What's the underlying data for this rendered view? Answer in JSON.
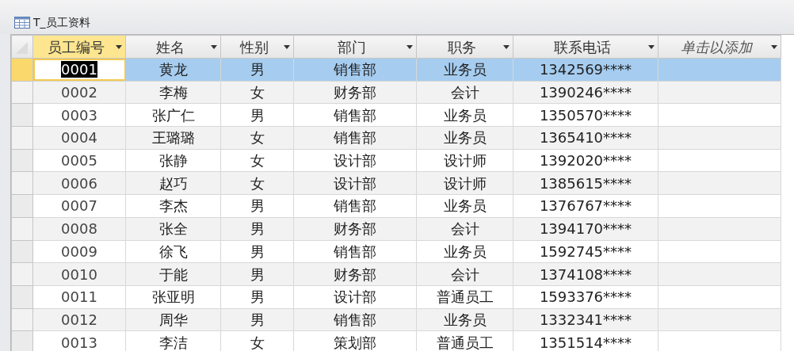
{
  "window": {
    "title": "T_员工资料"
  },
  "columns": [
    {
      "label": "员工编号",
      "selected": true,
      "kind": "field"
    },
    {
      "label": "姓名",
      "selected": false,
      "kind": "field"
    },
    {
      "label": "性别",
      "selected": false,
      "kind": "field"
    },
    {
      "label": "部门",
      "selected": false,
      "kind": "field"
    },
    {
      "label": "职务",
      "selected": false,
      "kind": "field"
    },
    {
      "label": "联系电话",
      "selected": false,
      "kind": "field"
    },
    {
      "label": "单击以添加",
      "selected": false,
      "kind": "add"
    }
  ],
  "rows": [
    {
      "selected": true,
      "cells": [
        "0001",
        "黄龙",
        "男",
        "销售部",
        "业务员",
        "1342569****"
      ]
    },
    {
      "selected": false,
      "cells": [
        "0002",
        "李梅",
        "女",
        "财务部",
        "会计",
        "1390246****"
      ]
    },
    {
      "selected": false,
      "cells": [
        "0003",
        "张广仁",
        "男",
        "销售部",
        "业务员",
        "1350570****"
      ]
    },
    {
      "selected": false,
      "cells": [
        "0004",
        "王璐璐",
        "女",
        "销售部",
        "业务员",
        "1365410****"
      ]
    },
    {
      "selected": false,
      "cells": [
        "0005",
        "张静",
        "女",
        "设计部",
        "设计师",
        "1392020****"
      ]
    },
    {
      "selected": false,
      "cells": [
        "0006",
        "赵巧",
        "女",
        "设计部",
        "设计师",
        "1385615****"
      ]
    },
    {
      "selected": false,
      "cells": [
        "0007",
        "李杰",
        "男",
        "销售部",
        "业务员",
        "1376767****"
      ]
    },
    {
      "selected": false,
      "cells": [
        "0008",
        "张全",
        "男",
        "财务部",
        "会计",
        "1394170****"
      ]
    },
    {
      "selected": false,
      "cells": [
        "0009",
        "徐飞",
        "男",
        "销售部",
        "业务员",
        "1592745****"
      ]
    },
    {
      "selected": false,
      "cells": [
        "0010",
        "于能",
        "男",
        "财务部",
        "会计",
        "1374108****"
      ]
    },
    {
      "selected": false,
      "cells": [
        "0011",
        "张亚明",
        "男",
        "设计部",
        "普通员工",
        "1593376****"
      ]
    },
    {
      "selected": false,
      "cells": [
        "0012",
        "周华",
        "男",
        "销售部",
        "业务员",
        "1332341****"
      ]
    },
    {
      "selected": false,
      "cells": [
        "0013",
        "李洁",
        "女",
        "策划部",
        "普通员工",
        "1351514****"
      ]
    }
  ]
}
